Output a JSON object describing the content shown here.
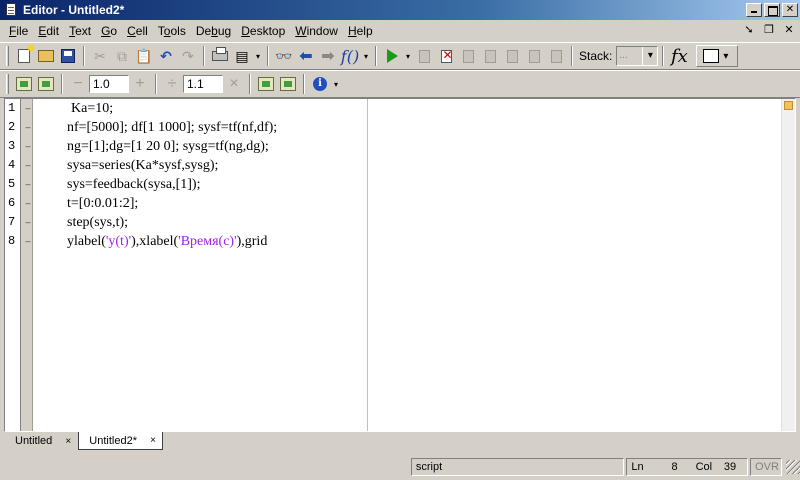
{
  "window": {
    "title": "Editor - Untitled2*"
  },
  "menu": {
    "items": [
      {
        "ul": "F",
        "rest": "ile"
      },
      {
        "ul": "E",
        "rest": "dit"
      },
      {
        "ul": "T",
        "rest": "ext"
      },
      {
        "ul": "G",
        "rest": "o"
      },
      {
        "ul": "C",
        "rest": "ell"
      },
      {
        "pre": "T",
        "ul": "o",
        "rest": "ols"
      },
      {
        "pre": "De",
        "ul": "b",
        "rest": "ug"
      },
      {
        "ul": "D",
        "rest": "esktop"
      },
      {
        "ul": "W",
        "rest": "indow"
      },
      {
        "ul": "H",
        "rest": "elp"
      }
    ]
  },
  "toolbar": {
    "stack_label": "Stack:",
    "stack_value": "..."
  },
  "cell_toolbar": {
    "decrement_value": "1.0",
    "multiply_value": "1.1"
  },
  "editor": {
    "line_numbers": [
      "1",
      "2",
      "3",
      "4",
      "5",
      "6",
      "7",
      "8"
    ],
    "lines": [
      "Ka=10;",
      "nf=[5000]; df[1 1000]; sysf=tf(nf,df);",
      "ng=[1];dg=[1 20 0]; sysg=tf(ng,dg);",
      "sysa=series(Ka*sysf,sysg);",
      "sys=feedback(sysa,[1]);",
      "t=[0:0.01:2];",
      "step(sys,t);"
    ],
    "last_line": {
      "p1": "ylabel(",
      "s1": "'y(t)'",
      "p2": "),xlabel(",
      "s2": "'Время(с)'",
      "p3": "),grid"
    },
    "string_color": "#a020f0"
  },
  "tabs": [
    {
      "label": "Untitled",
      "close": "×"
    },
    {
      "label": "Untitled2*",
      "close": "×"
    }
  ],
  "status": {
    "mode": "script",
    "ln_label": "Ln",
    "ln_value": "8",
    "col_label": "Col",
    "col_value": "39",
    "ovr": "OVR"
  }
}
